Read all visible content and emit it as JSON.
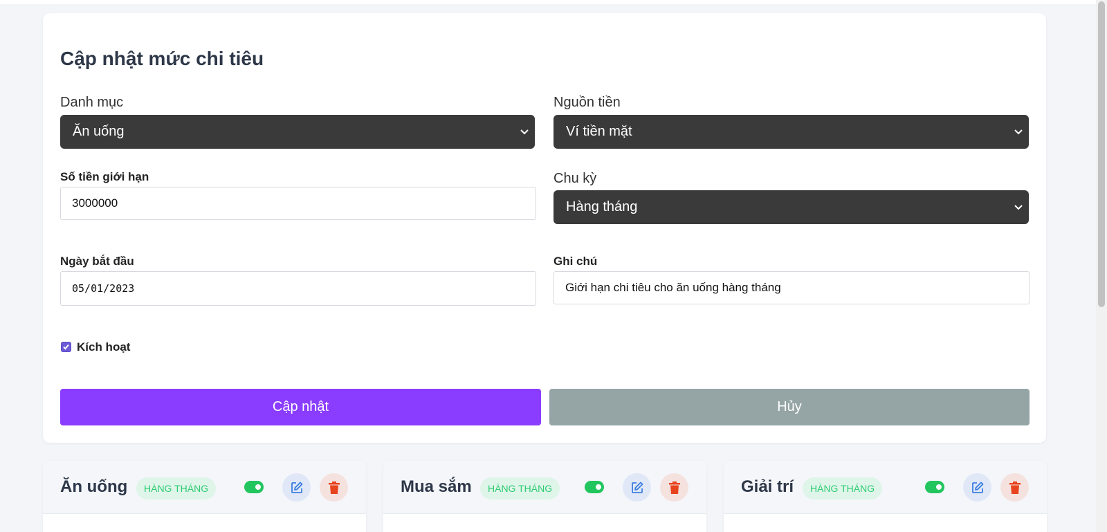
{
  "form": {
    "title": "Cập nhật mức chi tiêu",
    "category": {
      "label": "Danh mục",
      "value": "Ăn uống"
    },
    "source": {
      "label": "Nguồn tiền",
      "value": "Ví tiền mặt"
    },
    "limit": {
      "label": "Số tiền giới hạn",
      "value": "3000000"
    },
    "period": {
      "label": "Chu kỳ",
      "value": "Hàng tháng"
    },
    "start_date": {
      "label": "Ngày bắt đầu",
      "value": "05/01/2023"
    },
    "note": {
      "label": "Ghi chú",
      "value": "Giới hạn chi tiêu cho ăn uống hàng tháng"
    },
    "active": {
      "label": "Kích hoạt",
      "checked": true
    },
    "submit_label": "Cập nhật",
    "cancel_label": "Hủy"
  },
  "budgets": [
    {
      "title": "Ăn uống",
      "badge": "HÀNG THÁNG",
      "enabled": true
    },
    {
      "title": "Mua sắm",
      "badge": "HÀNG THÁNG",
      "enabled": true
    },
    {
      "title": "Giải trí",
      "badge": "HÀNG THÁNG",
      "enabled": true
    }
  ],
  "colors": {
    "primary": "#8a3cff",
    "secondary": "#95a5a6",
    "select_bg": "#3a3a3a",
    "badge_text": "#2ecc71",
    "toggle_on": "#22c55e",
    "edit_icon": "#3b7ddd",
    "delete_icon": "#e8431f"
  },
  "icons": {
    "select_arrow": "chevron-down-icon",
    "edit": "edit-icon",
    "delete": "trash-icon",
    "toggle": "toggle-icon"
  }
}
